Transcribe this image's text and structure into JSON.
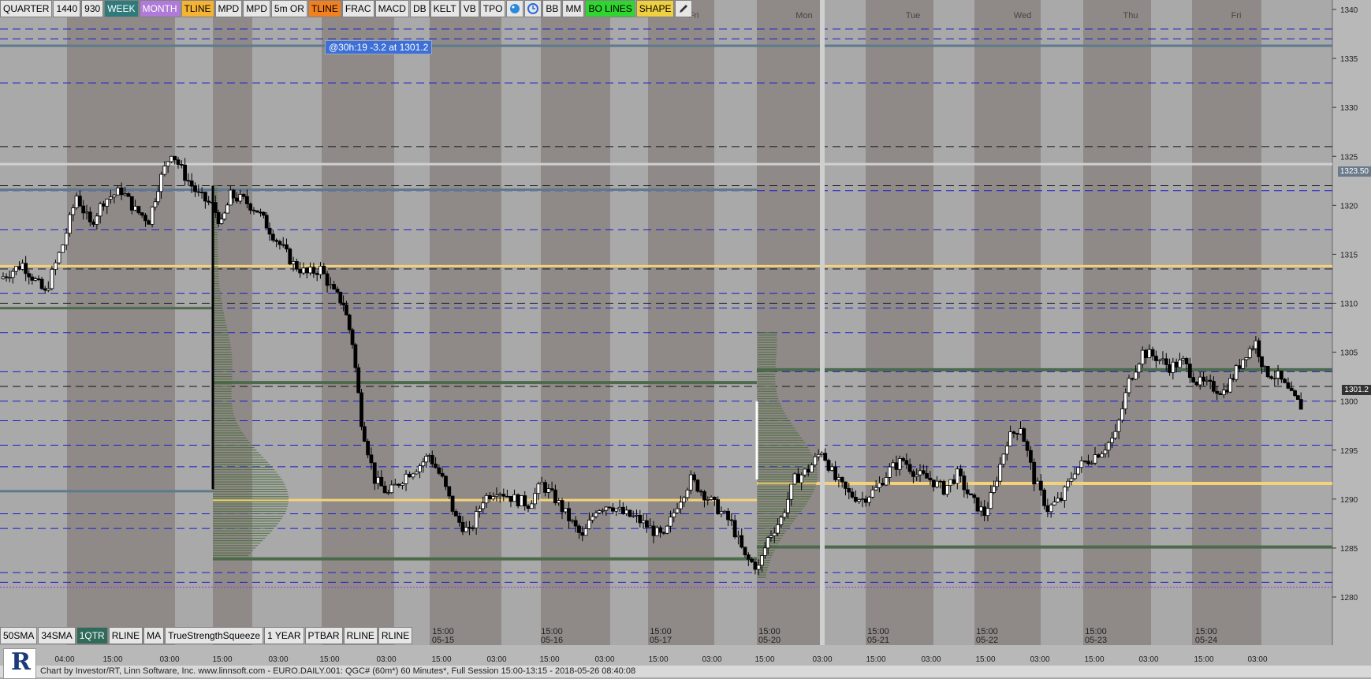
{
  "toolbar": {
    "buttons": [
      {
        "label": "QUARTER",
        "bg": "#e6e6e6",
        "fg": "#000"
      },
      {
        "label": "1440",
        "bg": "#e6e6e6",
        "fg": "#000"
      },
      {
        "label": "930",
        "bg": "#e6e6e6",
        "fg": "#000"
      },
      {
        "label": "WEEK",
        "bg": "#2f7a7a",
        "fg": "#fff"
      },
      {
        "label": "MONTH",
        "bg": "#b07ad8",
        "fg": "#fff"
      },
      {
        "label": "TLINE",
        "bg": "#f5b335",
        "fg": "#000"
      },
      {
        "label": "MPD",
        "bg": "#e6e6e6",
        "fg": "#000"
      },
      {
        "label": "MPD",
        "bg": "#e6e6e6",
        "fg": "#000"
      },
      {
        "label": "5m OR",
        "bg": "#e6e6e6",
        "fg": "#000"
      },
      {
        "label": "TLINE",
        "bg": "#f08020",
        "fg": "#000"
      },
      {
        "label": "FRAC",
        "bg": "#e6e6e6",
        "fg": "#000"
      },
      {
        "label": "MACD",
        "bg": "#e6e6e6",
        "fg": "#000"
      },
      {
        "label": "DB",
        "bg": "#e6e6e6",
        "fg": "#000"
      },
      {
        "label": "KELT",
        "bg": "#e6e6e6",
        "fg": "#000"
      },
      {
        "label": "VB",
        "bg": "#e6e6e6",
        "fg": "#000"
      },
      {
        "label": "TPO",
        "bg": "#e6e6e6",
        "fg": "#000"
      }
    ],
    "icons": [
      "palette-icon",
      "clock-icon"
    ],
    "buttons2": [
      {
        "label": "BB",
        "bg": "#e6e6e6",
        "fg": "#000"
      },
      {
        "label": "MM",
        "bg": "#e6e6e6",
        "fg": "#000"
      },
      {
        "label": "BO LINES",
        "bg": "#2fd62f",
        "fg": "#000"
      },
      {
        "label": "SHAPE",
        "bg": "#f0d040",
        "fg": "#000"
      }
    ]
  },
  "bottom_buttons": [
    {
      "label": "50SMA",
      "bg": "#e6e6e6",
      "fg": "#000"
    },
    {
      "label": "34SMA",
      "bg": "#e6e6e6",
      "fg": "#000"
    },
    {
      "label": "1QTR",
      "bg": "#2f6a5a",
      "fg": "#fff"
    },
    {
      "label": "RLINE",
      "bg": "#e6e6e6",
      "fg": "#000"
    },
    {
      "label": "MA",
      "bg": "#e6e6e6",
      "fg": "#000"
    },
    {
      "label": "TrueStrengthSqueeze",
      "bg": "#e6e6e6",
      "fg": "#000"
    },
    {
      "label": "1 YEAR",
      "bg": "#e6e6e6",
      "fg": "#000"
    },
    {
      "label": "PTBAR",
      "bg": "#e6e6e6",
      "fg": "#000"
    },
    {
      "label": "RLINE",
      "bg": "#e6e6e6",
      "fg": "#000"
    },
    {
      "label": "RLINE",
      "bg": "#e6e6e6",
      "fg": "#000"
    }
  ],
  "annotation": "@30h:19  -3.2 at 1301.2",
  "status_text": "Chart by Investor/RT, Linn Software, Inc. www.linnsoft.com - EURO.DAILY.001: QGC# (60m*) 60 Minutes*, Full Session 15:00-13:15 - 2018-05-26 08:40:08",
  "price_tags": [
    {
      "label": "1323.50",
      "price": 1323.5,
      "bg": "#6b7b8b",
      "fg": "#fff"
    },
    {
      "label": "1301.2",
      "price": 1301.2,
      "bg": "#333",
      "fg": "#fff"
    }
  ],
  "colors": {
    "band_light": "#a9a9a9",
    "band_dark": "#8f8a88",
    "blue_dash": "#1a1ad0",
    "black_dash": "#111",
    "yellow": "#f5d27a",
    "green": "#4c6a4c",
    "steel": "#5d7a8e",
    "profile": "#4a6a3a"
  },
  "chart_data": {
    "type": "candlestick",
    "symbol": "QGC#",
    "interval": "60 Minutes",
    "yaxis": {
      "ticks": [
        1280,
        1285,
        1290,
        1295,
        1300,
        1305,
        1310,
        1315,
        1320,
        1325,
        1330,
        1335,
        1340
      ],
      "range": [
        1278,
        1340.5
      ]
    },
    "top_day_labels": [
      "Fri",
      "Mon",
      "Tue",
      "Wed",
      "Thu",
      "Fri"
    ],
    "date_labels": [
      {
        "time": "15:00",
        "date": "05-15"
      },
      {
        "time": "15:00",
        "date": "05-16"
      },
      {
        "time": "15:00",
        "date": "05-17"
      },
      {
        "time": "15:00",
        "date": "05-20"
      },
      {
        "time": "15:00",
        "date": "05-21"
      },
      {
        "time": "15:00",
        "date": "05-22"
      },
      {
        "time": "15:00",
        "date": "05-23"
      },
      {
        "time": "15:00",
        "date": "05-24"
      }
    ],
    "time_labels": [
      "04:00",
      "15:00",
      "03:00",
      "15:00",
      "03:00",
      "15:00",
      "03:00",
      "15:00",
      "03:00",
      "15:00",
      "03:00",
      "15:00",
      "03:00",
      "15:00",
      "03:00",
      "15:00",
      "03:00",
      "15:00",
      "03:00",
      "15:00",
      "03:00",
      "15:00",
      "03:00"
    ],
    "close_path": [
      [
        0,
        1312.5
      ],
      [
        10,
        1314
      ],
      [
        20,
        1311
      ],
      [
        28,
        1316
      ],
      [
        34,
        1321
      ],
      [
        40,
        1318
      ],
      [
        46,
        1320.5
      ],
      [
        54,
        1321.5
      ],
      [
        60,
        1319.5
      ],
      [
        66,
        1318.5
      ],
      [
        70,
        1322
      ],
      [
        76,
        1325.5
      ],
      [
        82,
        1323
      ],
      [
        88,
        1321
      ],
      [
        94,
        1320
      ],
      [
        98,
        1318
      ],
      [
        102,
        1321
      ],
      [
        108,
        1320.5
      ],
      [
        114,
        1319.5
      ],
      [
        118,
        1318
      ],
      [
        124,
        1316
      ],
      [
        130,
        1314
      ],
      [
        136,
        1313
      ],
      [
        142,
        1313.5
      ],
      [
        148,
        1311
      ],
      [
        152,
        1310
      ],
      [
        156,
        1306
      ],
      [
        160,
        1298
      ],
      [
        166,
        1292
      ],
      [
        172,
        1290.5
      ],
      [
        180,
        1292.5
      ],
      [
        186,
        1293.5
      ],
      [
        190,
        1294.5
      ],
      [
        196,
        1292
      ],
      [
        202,
        1288
      ],
      [
        208,
        1286.5
      ],
      [
        214,
        1290
      ],
      [
        220,
        1291
      ],
      [
        228,
        1290
      ],
      [
        234,
        1289.5
      ],
      [
        240,
        1291.5
      ],
      [
        246,
        1290
      ],
      [
        252,
        1288
      ],
      [
        258,
        1286
      ],
      [
        264,
        1289
      ],
      [
        270,
        1289.5
      ],
      [
        276,
        1288.5
      ],
      [
        282,
        1288
      ],
      [
        288,
        1287
      ],
      [
        294,
        1286
      ],
      [
        300,
        1289.5
      ],
      [
        306,
        1292
      ],
      [
        312,
        1290.5
      ],
      [
        318,
        1289
      ],
      [
        324,
        1287.5
      ],
      [
        330,
        1284
      ],
      [
        336,
        1283
      ],
      [
        340,
        1286
      ],
      [
        346,
        1288
      ],
      [
        352,
        1292
      ],
      [
        358,
        1293
      ],
      [
        364,
        1295
      ],
      [
        370,
        1292
      ],
      [
        376,
        1290.5
      ],
      [
        382,
        1290
      ],
      [
        388,
        1291
      ],
      [
        394,
        1293
      ],
      [
        400,
        1294
      ],
      [
        406,
        1292.5
      ],
      [
        412,
        1292
      ],
      [
        418,
        1291
      ],
      [
        424,
        1292.5
      ],
      [
        430,
        1290
      ],
      [
        436,
        1288.5
      ],
      [
        440,
        1291
      ],
      [
        446,
        1296
      ],
      [
        452,
        1297.5
      ],
      [
        458,
        1292
      ],
      [
        464,
        1289
      ],
      [
        470,
        1290
      ],
      [
        476,
        1293
      ],
      [
        482,
        1294
      ],
      [
        488,
        1295
      ],
      [
        494,
        1296.5
      ],
      [
        500,
        1302
      ],
      [
        506,
        1305
      ],
      [
        512,
        1304.5
      ],
      [
        518,
        1303.5
      ],
      [
        524,
        1304
      ],
      [
        530,
        1302
      ],
      [
        536,
        1301.5
      ],
      [
        542,
        1301
      ],
      [
        546,
        1302.5
      ],
      [
        552,
        1305
      ],
      [
        556,
        1306
      ],
      [
        560,
        1303
      ],
      [
        566,
        1302.5
      ],
      [
        572,
        1300.5
      ],
      [
        576,
        1299.5
      ]
    ],
    "title": "",
    "xlabel": "",
    "ylabel": ""
  }
}
